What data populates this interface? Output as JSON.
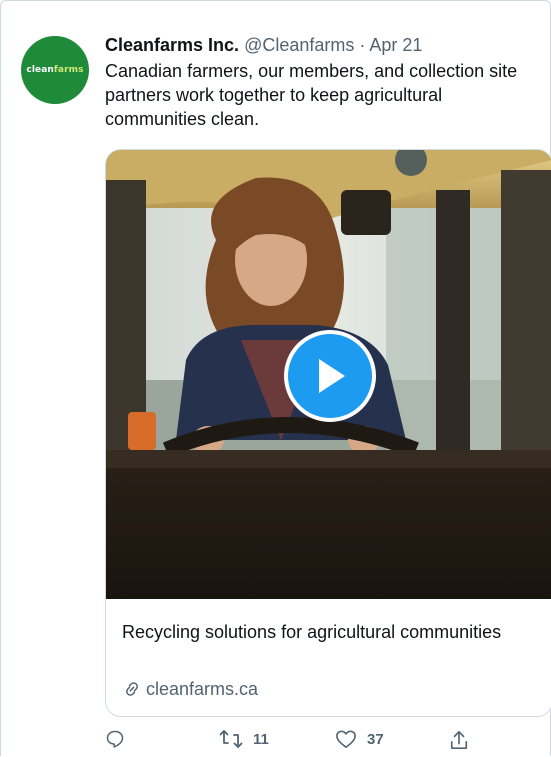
{
  "tweet": {
    "display_name": "Cleanfarms Inc.",
    "handle_date": "@Cleanfarms · Apr 21",
    "text": "Canadian farmers, our members, and collection site partners work together to keep agricultural communities clean.",
    "avatar": {
      "logo_main": "clean",
      "logo_sub": "farms",
      "bg_color": "#1f8a3a"
    }
  },
  "card": {
    "title": "Recycling solutions for agricultural communities",
    "domain": "cleanfarms.ca",
    "link_icon": "link-icon",
    "play_icon": "play-icon"
  },
  "actions": {
    "reply": {
      "icon": "reply-icon",
      "count": ""
    },
    "retweet": {
      "icon": "retweet-icon",
      "count": "11"
    },
    "like": {
      "icon": "heart-icon",
      "count": "37"
    },
    "share": {
      "icon": "share-icon",
      "count": ""
    }
  },
  "colors": {
    "accent": "#1d9bf0",
    "muted": "#536471",
    "text": "#0f1419",
    "border": "#cfd9de"
  }
}
